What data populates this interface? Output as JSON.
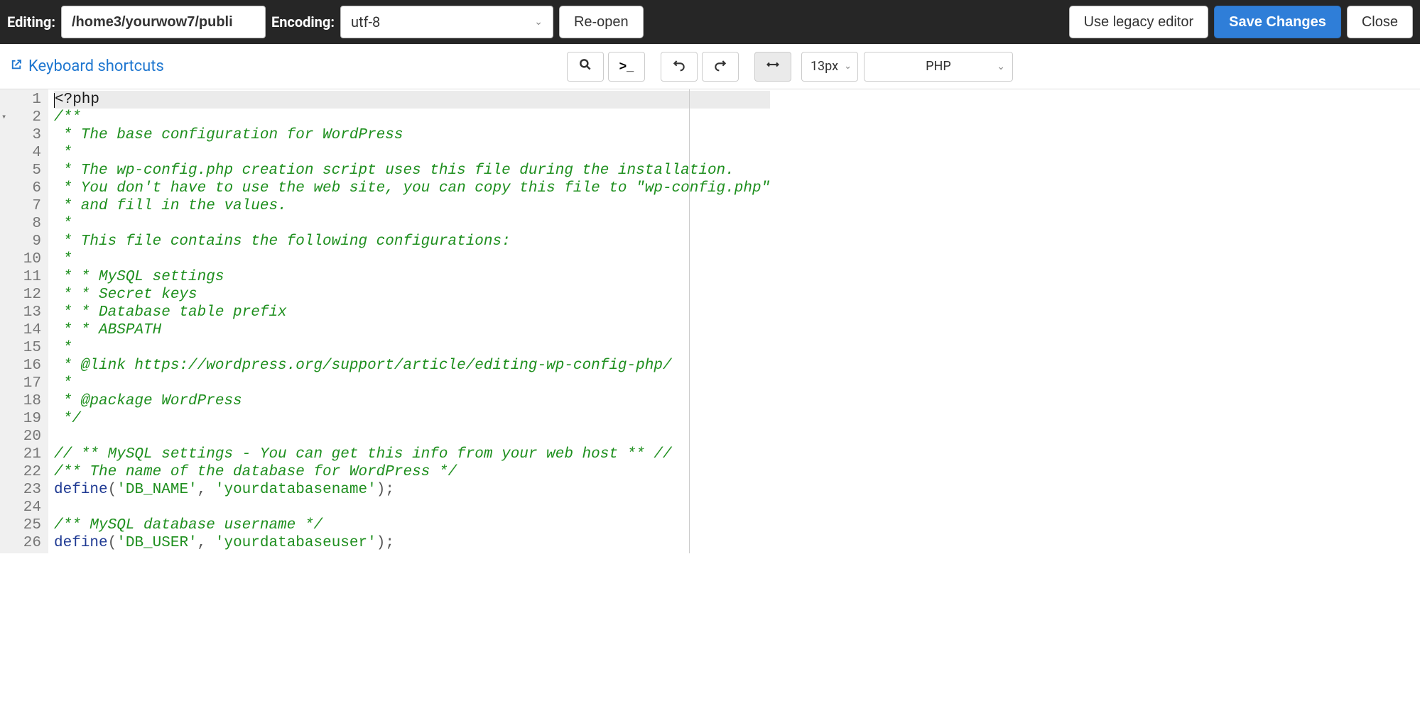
{
  "header": {
    "editing_label": "Editing:",
    "editing_value": "/home3/yourwow7/publi",
    "encoding_label": "Encoding:",
    "encoding_value": "utf-8",
    "reopen": "Re-open",
    "legacy": "Use legacy editor",
    "save": "Save Changes",
    "close": "Close"
  },
  "toolbar": {
    "kb_link": "Keyboard shortcuts",
    "font_size": "13px",
    "language": "PHP"
  },
  "code": {
    "lines": [
      {
        "n": 1,
        "t": "tag",
        "text": "<?php",
        "current": true
      },
      {
        "n": 2,
        "t": "cmt",
        "text": "/**",
        "fold": true
      },
      {
        "n": 3,
        "t": "cmt",
        "text": " * The base configuration for WordPress"
      },
      {
        "n": 4,
        "t": "cmt",
        "text": " *"
      },
      {
        "n": 5,
        "t": "cmt",
        "text": " * The wp-config.php creation script uses this file during the installation."
      },
      {
        "n": 6,
        "t": "cmt",
        "text": " * You don't have to use the web site, you can copy this file to \"wp-config.php\""
      },
      {
        "n": 7,
        "t": "cmt",
        "text": " * and fill in the values."
      },
      {
        "n": 8,
        "t": "cmt",
        "text": " *"
      },
      {
        "n": 9,
        "t": "cmt",
        "text": " * This file contains the following configurations:"
      },
      {
        "n": 10,
        "t": "cmt",
        "text": " *"
      },
      {
        "n": 11,
        "t": "cmt",
        "text": " * * MySQL settings"
      },
      {
        "n": 12,
        "t": "cmt",
        "text": " * * Secret keys"
      },
      {
        "n": 13,
        "t": "cmt",
        "text": " * * Database table prefix"
      },
      {
        "n": 14,
        "t": "cmt",
        "text": " * * ABSPATH"
      },
      {
        "n": 15,
        "t": "cmt",
        "text": " *"
      },
      {
        "n": 16,
        "t": "cmt",
        "text": " * @link https://wordpress.org/support/article/editing-wp-config-php/"
      },
      {
        "n": 17,
        "t": "cmt",
        "text": " *"
      },
      {
        "n": 18,
        "t": "cmt",
        "text": " * @package WordPress"
      },
      {
        "n": 19,
        "t": "cmt",
        "text": " */"
      },
      {
        "n": 20,
        "t": "plain",
        "text": ""
      },
      {
        "n": 21,
        "t": "cmt",
        "text": "// ** MySQL settings - You can get this info from your web host ** //"
      },
      {
        "n": 22,
        "t": "cmt",
        "text": "/** The name of the database for WordPress */"
      },
      {
        "n": 23,
        "t": "def",
        "func": "define",
        "args": [
          "'DB_NAME'",
          "'yourdatabasename'"
        ]
      },
      {
        "n": 24,
        "t": "plain",
        "text": ""
      },
      {
        "n": 25,
        "t": "cmt",
        "text": "/** MySQL database username */"
      },
      {
        "n": 26,
        "t": "def",
        "func": "define",
        "args": [
          "'DB_USER'",
          "'yourdatabaseuser'"
        ]
      }
    ]
  }
}
